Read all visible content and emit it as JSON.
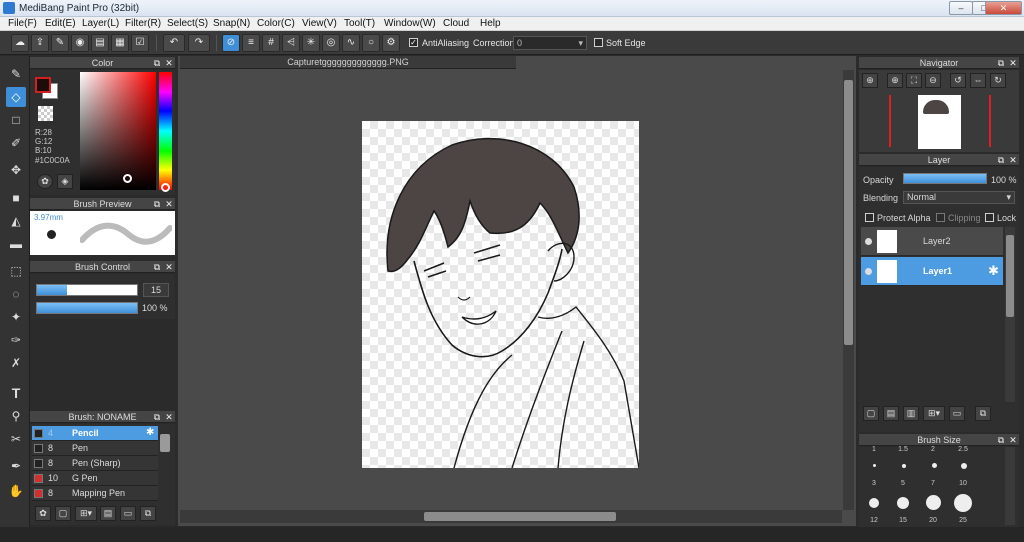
{
  "window": {
    "title": "MediBang Paint Pro (32bit)",
    "minimize": "–",
    "maximize": "□",
    "close": "✕"
  },
  "menu": [
    "File(F)",
    "Edit(E)",
    "Layer(L)",
    "Filter(R)",
    "Select(S)",
    "Snap(N)",
    "Color(C)",
    "View(V)",
    "Tool(T)",
    "Window(W)",
    "Cloud",
    "Help"
  ],
  "toolbar": {
    "antialiasing_label": "AntiAliasing",
    "correction_label": "Correction",
    "correction_value": "0",
    "soft_edge_label": "Soft Edge"
  },
  "color_panel": {
    "title": "Color",
    "r": "R:28",
    "g": "G:12",
    "b": "B:10",
    "hex": "#1C0C0A",
    "foreground": "#1c0c0a"
  },
  "brush_preview": {
    "title": "Brush Preview",
    "size": "3.97mm"
  },
  "brush_control": {
    "title": "Brush Control",
    "size_value": "15",
    "opacity_value": "100 %",
    "size_fraction": 0.3,
    "opacity_fraction": 1.0
  },
  "brush_list": {
    "title": "Brush: NONAME",
    "items": [
      {
        "size": "4",
        "name": "Pencil",
        "color": "#222222",
        "selected": true
      },
      {
        "size": "8",
        "name": "Pen",
        "color": "#222222",
        "selected": false
      },
      {
        "size": "8",
        "name": "Pen (Sharp)",
        "color": "#222222",
        "selected": false
      },
      {
        "size": "10",
        "name": "G Pen",
        "color": "#d03030",
        "selected": false
      },
      {
        "size": "8",
        "name": "Mapping Pen",
        "color": "#d03030",
        "selected": false
      }
    ]
  },
  "canvas": {
    "tab_title": "Capturetggggggggggggg.PNG"
  },
  "navigator": {
    "title": "Navigator"
  },
  "layer_panel": {
    "title": "Layer",
    "opacity_label": "Opacity",
    "opacity_value": "100 %",
    "opacity_fraction": 1.0,
    "blending_label": "Blending",
    "blending_value": "Normal",
    "protect_alpha_label": "Protect Alpha",
    "clipping_label": "Clipping",
    "lock_label": "Lock",
    "layers": [
      {
        "name": "Layer2",
        "selected": false
      },
      {
        "name": "Layer1",
        "selected": true
      }
    ]
  },
  "brush_size": {
    "title": "Brush Size",
    "row_labels_top": [
      "1",
      "1.5",
      "2",
      "2.5"
    ],
    "row1": [
      "3",
      "5",
      "7",
      "10"
    ],
    "row2": [
      "12",
      "15",
      "20",
      "25"
    ]
  },
  "icons": {
    "close": "✕",
    "float": "⧉",
    "gear": "✱"
  }
}
